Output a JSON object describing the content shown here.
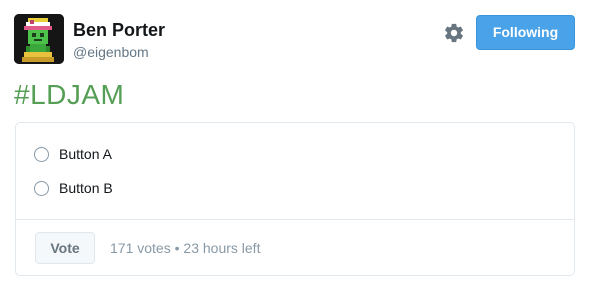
{
  "user": {
    "name": "Ben Porter",
    "handle": "@eigenbom",
    "avatar_icon": "pixel-art-character-avatar"
  },
  "header": {
    "settings_icon": "gear-icon",
    "follow_button_label": "Following"
  },
  "tweet": {
    "text": "#LDJAM"
  },
  "poll": {
    "options": [
      {
        "label": "Button A",
        "selected": false
      },
      {
        "label": "Button B",
        "selected": false
      }
    ],
    "vote_button_label": "Vote",
    "votes": "171 votes",
    "separator": "•",
    "time_left": "23 hours left"
  },
  "colors": {
    "follow_button_bg": "#4aa3e8",
    "hashtag": "#559e55",
    "muted_text": "#8899a6"
  }
}
